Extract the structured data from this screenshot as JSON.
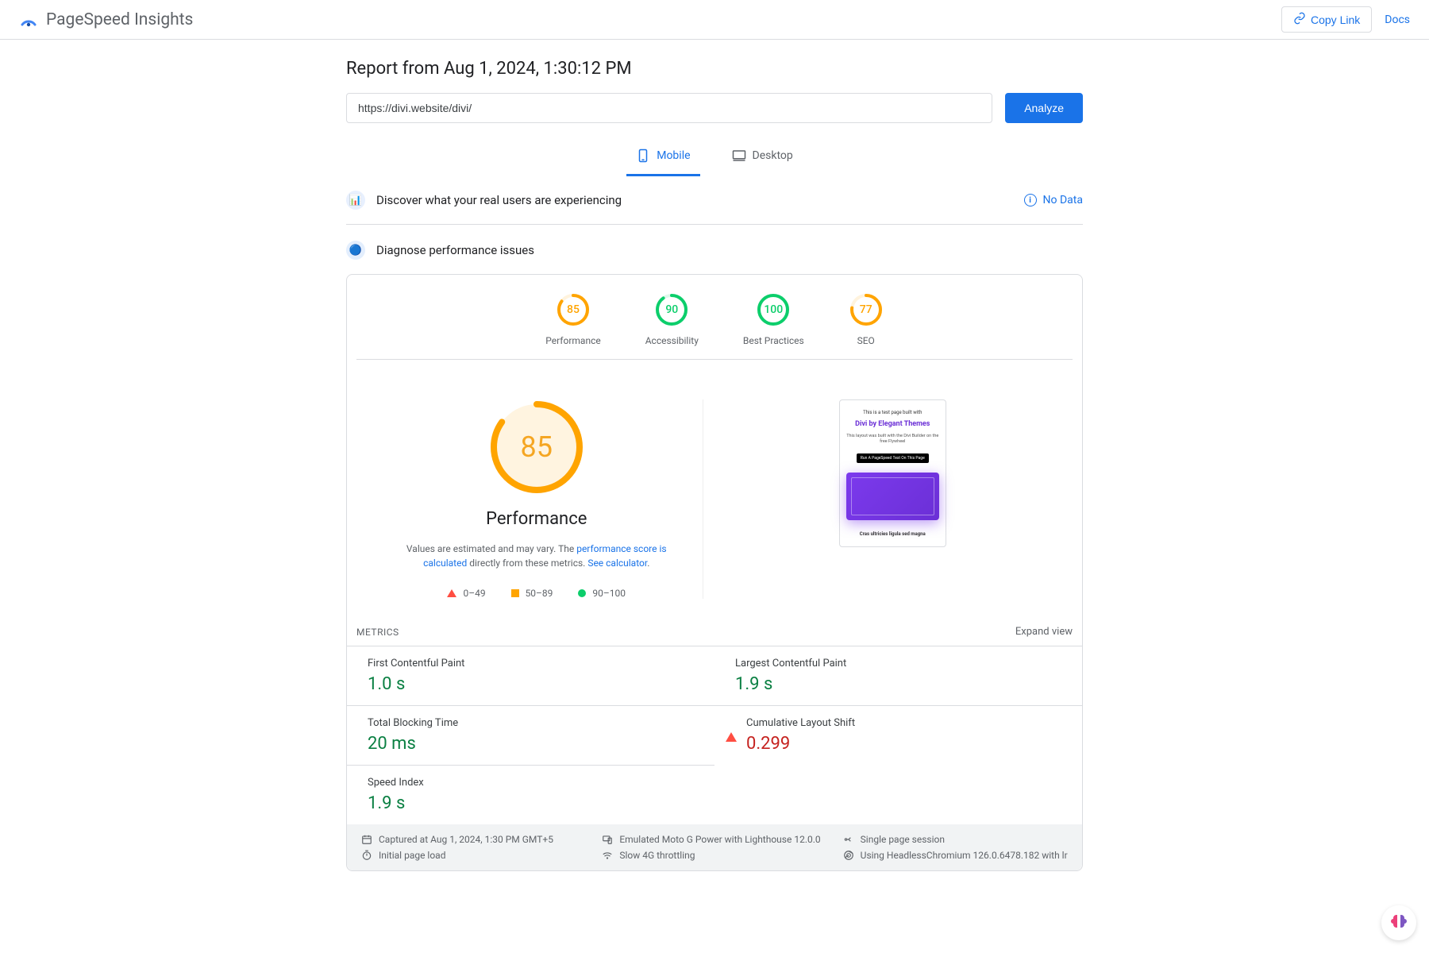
{
  "header": {
    "app_title": "PageSpeed Insights",
    "copy_link": "Copy Link",
    "docs": "Docs"
  },
  "report": {
    "title": "Report from Aug 1, 2024, 1:30:12 PM",
    "url": "https://divi.website/divi/",
    "analyze_label": "Analyze"
  },
  "tabs": {
    "mobile": "Mobile",
    "desktop": "Desktop"
  },
  "discover": {
    "title": "Discover what your real users are experiencing",
    "no_data": "No Data"
  },
  "diagnose": {
    "title": "Diagnose performance issues"
  },
  "gauges": [
    {
      "score": "85",
      "label": "Performance",
      "color": "#ffa400",
      "pct": 85
    },
    {
      "score": "90",
      "label": "Accessibility",
      "color": "#0cce6b",
      "pct": 90
    },
    {
      "score": "100",
      "label": "Best Practices",
      "color": "#0cce6b",
      "pct": 100
    },
    {
      "score": "77",
      "label": "SEO",
      "color": "#ffa400",
      "pct": 77
    }
  ],
  "performance": {
    "score": "85",
    "heading": "Performance",
    "desc_prefix": "Values are estimated and may vary. The ",
    "link1": "performance score is calculated",
    "desc_mid": " directly from these metrics. ",
    "link2": "See calculator",
    "desc_suffix": "."
  },
  "legend": {
    "red": "0–49",
    "orange": "50–89",
    "green": "90–100"
  },
  "screenshot": {
    "line1": "This is a test page built with",
    "line2": "Divi by Elegant Themes",
    "line3": "This layout was built with the Divi Builder on the free Flywheel",
    "btn": "Run A PageSpeed Test On This Page",
    "footer": "Cras ultricies ligula sed magna"
  },
  "metrics": {
    "heading": "METRICS",
    "expand": "Expand view",
    "items": [
      {
        "name": "First Contentful Paint",
        "value": "1.0 s",
        "status": "green"
      },
      {
        "name": "Largest Contentful Paint",
        "value": "1.9 s",
        "status": "green"
      },
      {
        "name": "Total Blocking Time",
        "value": "20 ms",
        "status": "green"
      },
      {
        "name": "Cumulative Layout Shift",
        "value": "0.299",
        "status": "red"
      },
      {
        "name": "Speed Index",
        "value": "1.9 s",
        "status": "green"
      }
    ]
  },
  "env": {
    "captured": "Captured at Aug 1, 2024, 1:30 PM GMT+5",
    "emulated": "Emulated Moto G Power with Lighthouse 12.0.0",
    "session": "Single page session",
    "load": "Initial page load",
    "throttle": "Slow 4G throttling",
    "browser": "Using HeadlessChromium 126.0.6478.182 with lr"
  }
}
